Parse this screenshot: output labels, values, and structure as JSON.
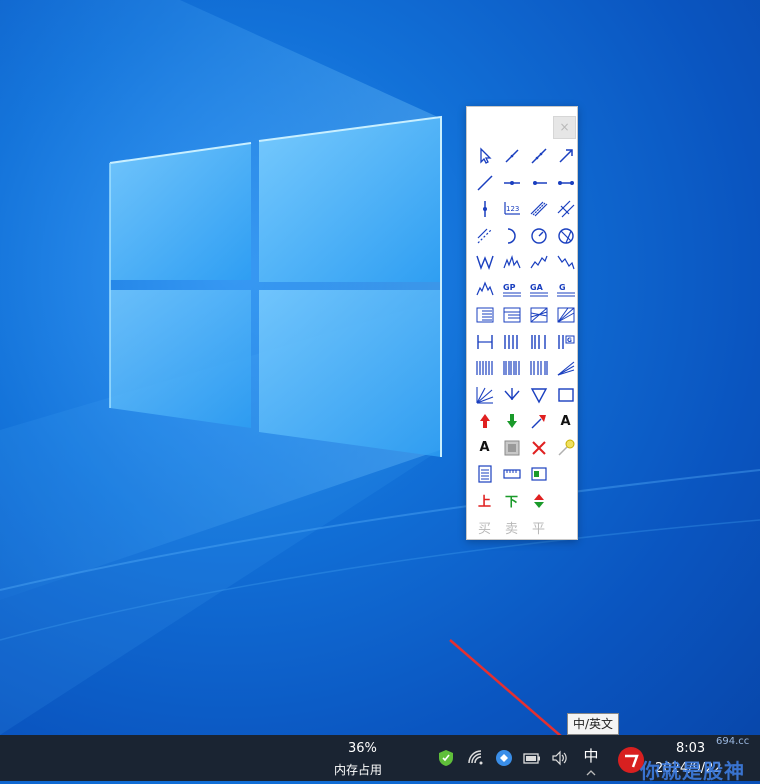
{
  "toolbar": {
    "close_label": "×",
    "text_tool_label": "A",
    "text_tool2_label": "A",
    "up_label": "上",
    "down_label": "下",
    "buy_label": "买",
    "sell_label": "卖",
    "flat_label": "平",
    "gp_label": "GP",
    "ga_label": "GA",
    "g_label": "G",
    "num_label": "123"
  },
  "tooltip": {
    "text": "中/英文"
  },
  "taskbar": {
    "memory_percent": "36%",
    "memory_label": "内存占用",
    "ime_label": "中",
    "time": "8:03",
    "date": "2024/9/22"
  },
  "watermark": {
    "site": "694.cc",
    "text": "你就是股神"
  },
  "colors": {
    "accent_blue": "#1a3fbf",
    "up_red": "#e02020",
    "down_green": "#1a9a2a",
    "taskbar": "#1a2432"
  }
}
